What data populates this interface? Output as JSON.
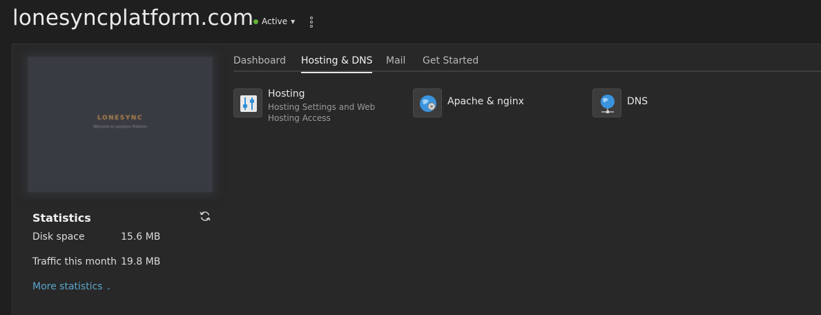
{
  "header": {
    "domain": "lonesyncplatform.com",
    "status": "Active"
  },
  "preview": {
    "logo_text": "LONESYNC",
    "logo_tagline": "Welcome to LoneSync Platform"
  },
  "statistics": {
    "title": "Statistics",
    "rows": [
      {
        "label": "Disk space",
        "value": "15.6 MB"
      },
      {
        "label": "Traffic this month",
        "value": "19.8 MB"
      }
    ],
    "more_label": "More statistics"
  },
  "tabs": [
    {
      "label": "Dashboard"
    },
    {
      "label": "Hosting & DNS",
      "active": true
    },
    {
      "label": "Mail"
    },
    {
      "label": "Get Started"
    }
  ],
  "tiles": [
    {
      "name": "Hosting",
      "description": "Hosting Settings and Web Hosting Access",
      "icon": "sliders-icon"
    },
    {
      "name": "Apache & nginx",
      "description": "",
      "icon": "globe-gear-icon"
    },
    {
      "name": "DNS",
      "description": "",
      "icon": "globe-network-icon"
    }
  ],
  "colors": {
    "status_green": "#62b338",
    "link_blue": "#5aa6cc",
    "icon_blue": "#2f8fd6"
  }
}
